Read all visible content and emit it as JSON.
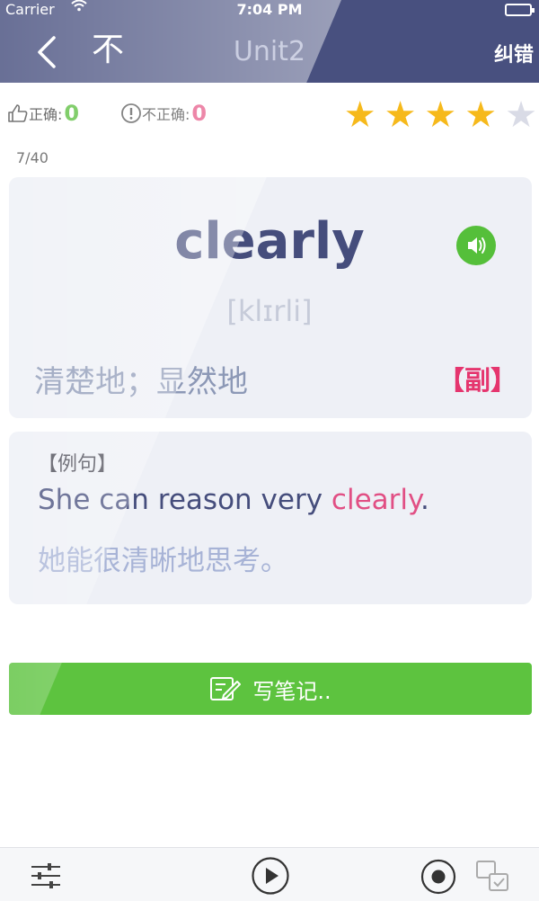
{
  "status": {
    "carrier": "Carrier",
    "time": "7:04 PM"
  },
  "nav": {
    "title": "Unit2",
    "close_label": "不",
    "report_label": "纠错"
  },
  "stats": {
    "correct_label": "正确:",
    "correct_count": "0",
    "wrong_label": "不正确:",
    "wrong_count": "0",
    "rating": 4,
    "rating_max": 5
  },
  "progress": {
    "counter": "7/40"
  },
  "word": {
    "text": "clearly",
    "phonetic": "[klɪrli]",
    "meaning": "清楚地；显然地",
    "pos": "【副】"
  },
  "example": {
    "label": "【例句】",
    "en_before": "She can reason very ",
    "en_highlight": "clearly",
    "en_after": ".",
    "zh": "她能很清晰地思考。"
  },
  "note_button": {
    "label": "写笔记.."
  },
  "colors": {
    "header": "#48507f",
    "accent_green": "#5dc33f",
    "accent_pink": "#e5356e",
    "star_on": "#f6b91b",
    "star_off": "#d9dbe6"
  },
  "icons": {
    "back": "chevron-left-icon",
    "speaker": "speaker-icon",
    "note": "edit-note-icon",
    "settings": "sliders-icon",
    "play": "play-icon",
    "record": "record-icon",
    "switch": "switch-cards-icon"
  }
}
